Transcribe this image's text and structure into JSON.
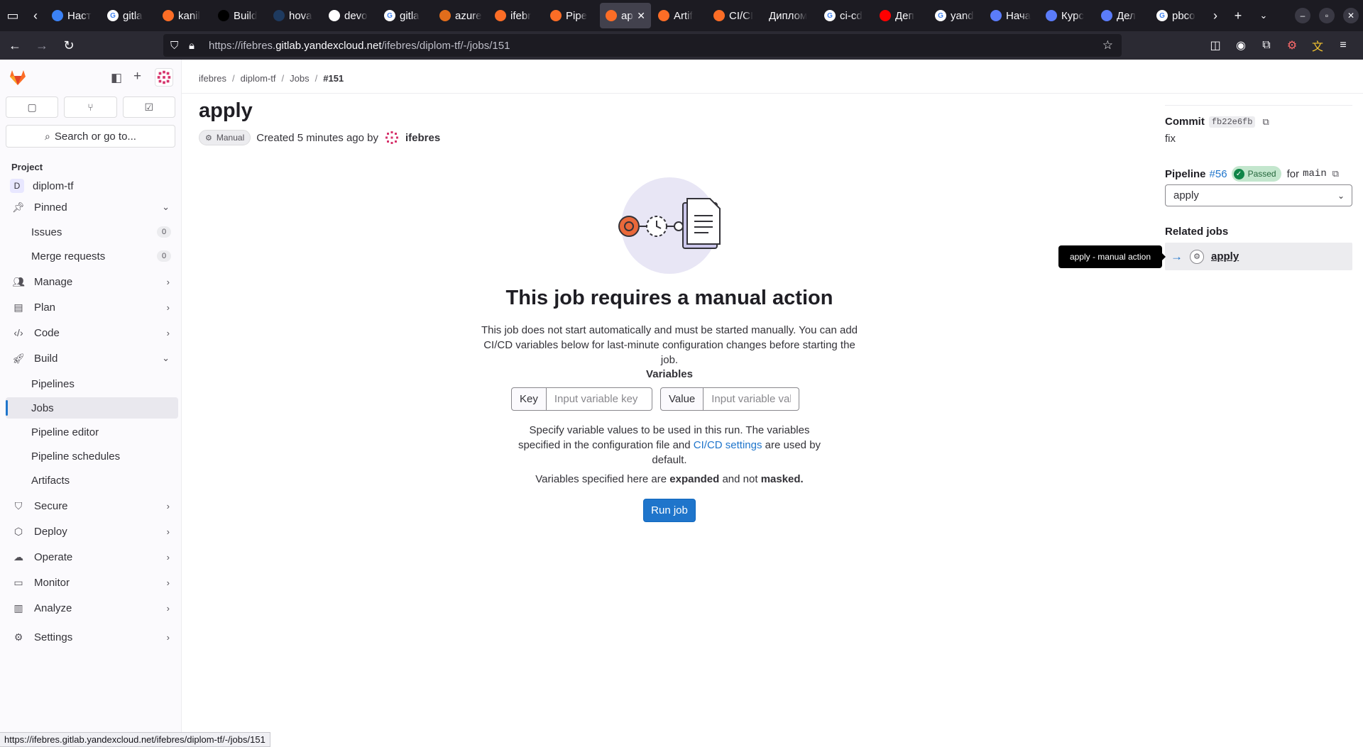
{
  "browser": {
    "tabs": [
      {
        "title": "Наст",
        "fav_color": "#3b82f6",
        "fav_glyph": ""
      },
      {
        "title": "gitla",
        "fav_color": "#ffffff",
        "fav_glyph": "G"
      },
      {
        "title": "kanil",
        "fav_color": "#fc6d26",
        "fav_glyph": ""
      },
      {
        "title": "Build",
        "fav_color": "#000000",
        "fav_glyph": ""
      },
      {
        "title": "hova",
        "fav_color": "#1e3a5f",
        "fav_glyph": ""
      },
      {
        "title": "devo",
        "fav_color": "#ffffff",
        "fav_glyph": ""
      },
      {
        "title": "gitla",
        "fav_color": "#ffffff",
        "fav_glyph": "G"
      },
      {
        "title": "azure",
        "fav_color": "#e26d1b",
        "fav_glyph": ""
      },
      {
        "title": "ifebr",
        "fav_color": "#fc6d26",
        "fav_glyph": ""
      },
      {
        "title": "Pipe",
        "fav_color": "#fc6d26",
        "fav_glyph": ""
      },
      {
        "title": "apply",
        "fav_color": "#fc6d26",
        "fav_glyph": "",
        "active": true
      },
      {
        "title": "Artif",
        "fav_color": "#fc6d26",
        "fav_glyph": ""
      },
      {
        "title": "CI/CI",
        "fav_color": "#fc6d26",
        "fav_glyph": ""
      },
      {
        "title": "Диплом",
        "fav_color": "",
        "fav_glyph": ""
      },
      {
        "title": "ci-cd",
        "fav_color": "#ffffff",
        "fav_glyph": "G"
      },
      {
        "title": "Деп",
        "fav_color": "#ff0000",
        "fav_glyph": ""
      },
      {
        "title": "yand",
        "fav_color": "#ffffff",
        "fav_glyph": "G"
      },
      {
        "title": "Нача",
        "fav_color": "#5b7cfa",
        "fav_glyph": ""
      },
      {
        "title": "Курс",
        "fav_color": "#5b7cfa",
        "fav_glyph": ""
      },
      {
        "title": "Дел",
        "fav_color": "#5b7cfa",
        "fav_glyph": ""
      },
      {
        "title": "pbco",
        "fav_color": "#ffffff",
        "fav_glyph": "G"
      }
    ],
    "url_prefix": "https://ifebres.",
    "url_host": "gitlab.yandexcloud.net",
    "url_path": "/ifebres/diplom-tf/-/jobs/151",
    "status_url": "https://ifebres.gitlab.yandexcloud.net/ifebres/diplom-tf/-/jobs/151"
  },
  "sidebar": {
    "search_label": "Search or go to...",
    "section_label": "Project",
    "project_initial": "D",
    "project_name": "diplom-tf",
    "pinned": "Pinned",
    "issues": "Issues",
    "issues_count": "0",
    "merge_requests": "Merge requests",
    "mr_count": "0",
    "manage": "Manage",
    "plan": "Plan",
    "code": "Code",
    "build": "Build",
    "pipelines": "Pipelines",
    "jobs": "Jobs",
    "pipeline_editor": "Pipeline editor",
    "pipeline_schedules": "Pipeline schedules",
    "artifacts": "Artifacts",
    "secure": "Secure",
    "deploy": "Deploy",
    "operate": "Operate",
    "monitor": "Monitor",
    "analyze": "Analyze",
    "settings": "Settings"
  },
  "breadcrumbs": {
    "c1": "ifebres",
    "c2": "diplom-tf",
    "c3": "Jobs",
    "c4": "#151"
  },
  "job": {
    "title": "apply",
    "status_badge": "Manual",
    "created_text": "Created 5 minutes ago by",
    "user": "ifebres"
  },
  "empty_state": {
    "title": "This job requires a manual action",
    "description": "This job does not start automatically and must be started manually. You can add CI/CD variables below for last-minute configuration changes before starting the job.",
    "variables_label": "Variables",
    "key_label": "Key",
    "key_placeholder": "Input variable key",
    "value_label": "Value",
    "value_placeholder": "Input variable value",
    "help_part1": "Specify variable values to be used in this run. The variables specified in the configuration file and ",
    "help_link": "CI/CD settings",
    "help_part2": " are used by default.",
    "help2_part1": "Variables specified here are ",
    "help2_bold1": "expanded",
    "help2_part2": " and not ",
    "help2_bold2": "masked.",
    "run_button": "Run job"
  },
  "right_sidebar": {
    "commit_label": "Commit",
    "commit_sha": "fb22e6fb",
    "commit_message": "fix",
    "pipeline_label": "Pipeline",
    "pipeline_id": "#56",
    "pipeline_status": "Passed",
    "for_text": "for",
    "branch": "main",
    "stage_selected": "apply",
    "related_jobs_label": "Related jobs",
    "related_job": "apply",
    "tooltip": "apply - manual action"
  },
  "colors": {
    "brand_orange": "#fc6d26",
    "link_blue": "#1f75cb",
    "passed_green": "#108548"
  }
}
